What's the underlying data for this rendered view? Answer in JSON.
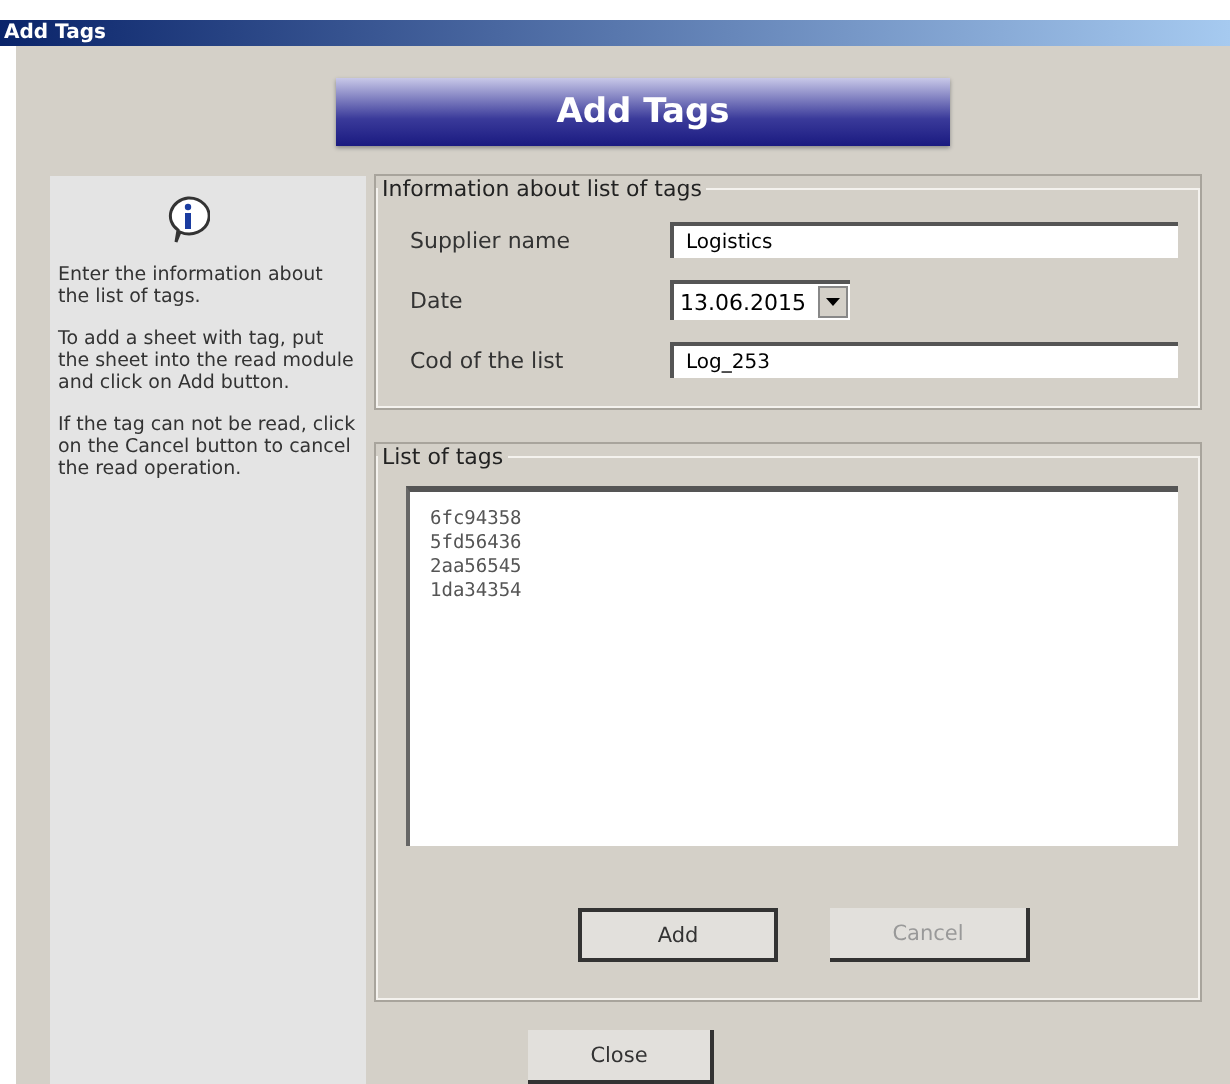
{
  "window": {
    "title": "Add Tags"
  },
  "header": {
    "title": "Add Tags"
  },
  "help": {
    "paragraphs": [
      "Enter the information about the list of tags.",
      "To add a sheet with tag, put the sheet into the read module and click on Add button.",
      "If the tag can not be read, click on the Cancel button to cancel the read operation."
    ]
  },
  "info_group": {
    "title": "Information about list of tags",
    "fields": [
      {
        "kind": "text",
        "label": "Supplier name",
        "value": "Logistics"
      },
      {
        "kind": "dropdown",
        "label": "Date",
        "value": "13.06.2015"
      },
      {
        "kind": "text",
        "label": "Cod of the list",
        "value": "Log_253"
      }
    ]
  },
  "tags_group": {
    "title": "List of tags",
    "items": [
      "6fc94358",
      "5fd56436",
      "2aa56545",
      "1da34354"
    ],
    "buttons": [
      {
        "label": "Add",
        "disabled": false
      },
      {
        "label": "Cancel",
        "disabled": true
      }
    ]
  },
  "close_button": {
    "label": "Close"
  }
}
